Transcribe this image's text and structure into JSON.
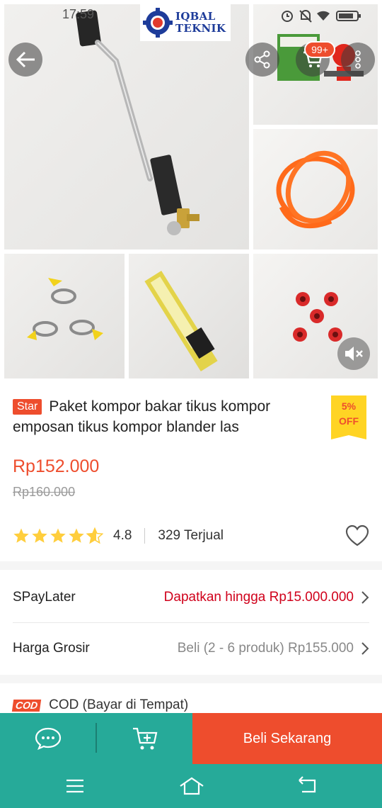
{
  "status_bar": {
    "time": "17:59"
  },
  "gallery": {
    "logo_text_line1": "IQBAL",
    "logo_text_line2": "TEKNIK",
    "cart_count": "99+"
  },
  "product": {
    "badge": "Star",
    "title": "Paket kompor bakar tikus kompor emposan tikus kompor blander las",
    "discount_line1": "5%",
    "discount_line2": "OFF",
    "price": "Rp152.000",
    "original_price": "Rp160.000",
    "rating": "4.8",
    "rating_fraction": 0.96,
    "sold": "329 Terjual"
  },
  "rows": {
    "paylater_label": "SPayLater",
    "paylater_value": "Dapatkan hingga Rp15.000.000",
    "grosir_label": "Harga Grosir",
    "grosir_value": "Beli (2 - 6 produk) Rp155.000",
    "cod_logo": "COD",
    "cod_label": "COD (Bayar di Tempat)"
  },
  "action_bar": {
    "buy_label": "Beli Sekarang"
  },
  "colors": {
    "brand": "#ee4d2d",
    "teal": "#26aa99",
    "paylater": "#d0011b",
    "star": "#ffce3d"
  }
}
